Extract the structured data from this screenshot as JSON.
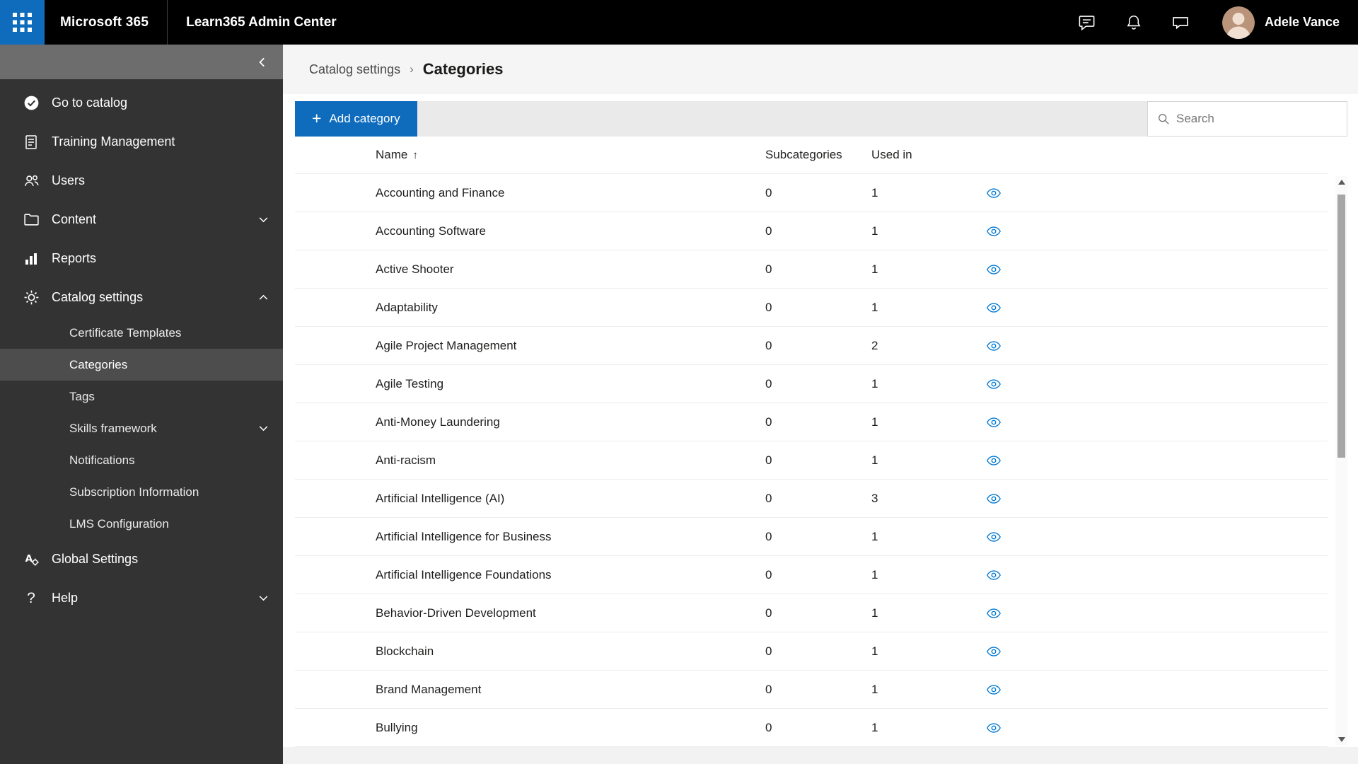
{
  "topbar": {
    "brand": "Microsoft 365",
    "app_title": "Learn365 Admin Center",
    "user_name": "Adele Vance"
  },
  "sidebar": {
    "items": [
      {
        "label": "Go to catalog",
        "icon": "catalog-check-icon"
      },
      {
        "label": "Training Management",
        "icon": "training-document-icon"
      },
      {
        "label": "Users",
        "icon": "people-icon"
      },
      {
        "label": "Content",
        "icon": "folder-icon",
        "chevron": "down"
      },
      {
        "label": "Reports",
        "icon": "bar-chart-icon"
      },
      {
        "label": "Catalog settings",
        "icon": "gear-icon",
        "chevron": "up",
        "expanded": true
      },
      {
        "label": "Global Settings",
        "icon": "language-settings-icon"
      },
      {
        "label": "Help",
        "icon": "question-mark-icon",
        "chevron": "down"
      }
    ],
    "subitems": [
      {
        "label": "Certificate Templates"
      },
      {
        "label": "Categories",
        "active": true
      },
      {
        "label": "Tags"
      },
      {
        "label": "Skills framework",
        "chevron": "down"
      },
      {
        "label": "Notifications"
      },
      {
        "label": "Subscription Information"
      },
      {
        "label": "LMS Configuration"
      }
    ]
  },
  "breadcrumb": {
    "parent": "Catalog settings",
    "current": "Categories"
  },
  "toolbar": {
    "add_button_label": "Add category",
    "search_placeholder": "Search",
    "search_value": ""
  },
  "table": {
    "columns": {
      "name": "Name",
      "subcategories": "Subcategories",
      "used_in": "Used in"
    },
    "sort": {
      "column": "Name",
      "direction": "ascending"
    },
    "rows": [
      {
        "name": "Accounting and Finance",
        "subcategories": "0",
        "used_in": "1"
      },
      {
        "name": "Accounting Software",
        "subcategories": "0",
        "used_in": "1"
      },
      {
        "name": "Active Shooter",
        "subcategories": "0",
        "used_in": "1"
      },
      {
        "name": "Adaptability",
        "subcategories": "0",
        "used_in": "1"
      },
      {
        "name": "Agile Project Management",
        "subcategories": "0",
        "used_in": "2"
      },
      {
        "name": "Agile Testing",
        "subcategories": "0",
        "used_in": "1"
      },
      {
        "name": "Anti-Money Laundering",
        "subcategories": "0",
        "used_in": "1"
      },
      {
        "name": "Anti-racism",
        "subcategories": "0",
        "used_in": "1"
      },
      {
        "name": "Artificial Intelligence (AI)",
        "subcategories": "0",
        "used_in": "3"
      },
      {
        "name": "Artificial Intelligence for Business",
        "subcategories": "0",
        "used_in": "1"
      },
      {
        "name": "Artificial Intelligence Foundations",
        "subcategories": "0",
        "used_in": "1"
      },
      {
        "name": "Behavior-Driven Development",
        "subcategories": "0",
        "used_in": "1"
      },
      {
        "name": "Blockchain",
        "subcategories": "0",
        "used_in": "1"
      },
      {
        "name": "Brand Management",
        "subcategories": "0",
        "used_in": "1"
      },
      {
        "name": "Bullying",
        "subcategories": "0",
        "used_in": "1"
      }
    ]
  },
  "glyphs": {
    "plus": "+",
    "sort_ascending": "↑",
    "help": "?",
    "breadcrumb_separator": "›"
  },
  "colors": {
    "topbar_bg": "#000000",
    "accent_blue": "#0f6cbd",
    "sidebar_bg": "#333333",
    "sidebar_active_bg": "#4d4d4d",
    "toolbar_bg": "#eaeaea",
    "eye_icon_blue": "#0078d4",
    "row_border": "#ededed"
  }
}
